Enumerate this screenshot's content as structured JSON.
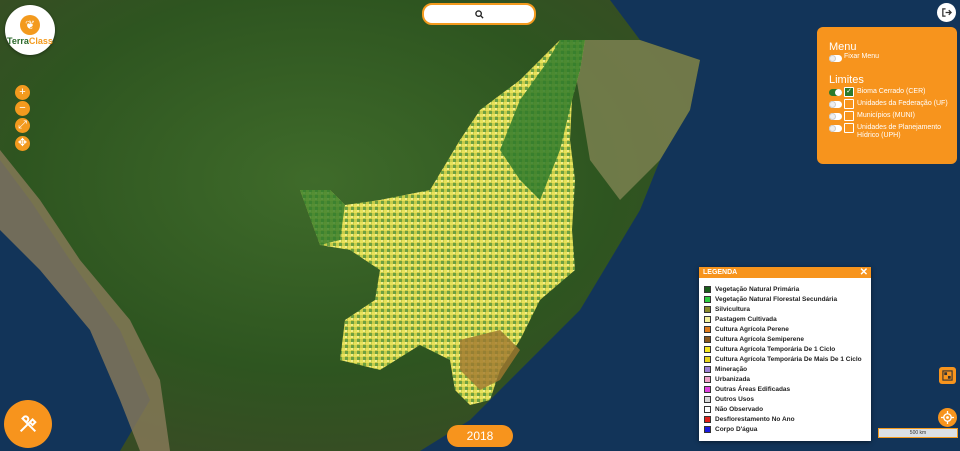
{
  "app": {
    "logo_line1": "Terra",
    "logo_line2": "Class"
  },
  "search": {
    "icon": "search-icon"
  },
  "zoom": {
    "in": "+",
    "out": "−"
  },
  "menu": {
    "title": "Menu",
    "fix_label": "Fixar Menu",
    "limits_title": "Limites",
    "limits": [
      {
        "label": "Bioma Cerrado (CER)",
        "on": true
      },
      {
        "label": "Unidades da Federação (UF)",
        "on": false
      },
      {
        "label": "Municípios (MUNI)",
        "on": false
      },
      {
        "label": "Unidades de Planejamento",
        "label2": "Hídrico (UPH)",
        "on": false
      }
    ]
  },
  "legend": {
    "title": "LEGENDA",
    "items": [
      {
        "label": "Vegetação Natural Primária",
        "color": "#1b5e1b"
      },
      {
        "label": "Vegetação Natural Florestal Secundária",
        "color": "#2ecc40"
      },
      {
        "label": "Silvicultura",
        "color": "#8a8a2a"
      },
      {
        "label": "Pastagem Cultivada",
        "color": "#f4f09a"
      },
      {
        "label": "Cultura Agrícola Perene",
        "color": "#e07b1a"
      },
      {
        "label": "Cultura Agrícola Semiperene",
        "color": "#8b5a1e"
      },
      {
        "label": "Cultura Agrícola Temporária De 1 Ciclo",
        "color": "#f5e61e"
      },
      {
        "label": "Cultura Agrícola Temporária De Mais De 1 Ciclo",
        "color": "#e6d41a"
      },
      {
        "label": "Mineração",
        "color": "#9b7fd4"
      },
      {
        "label": "Urbanizada",
        "color": "#f0a0c8"
      },
      {
        "label": "Outras Áreas Edificadas",
        "color": "#e040e0"
      },
      {
        "label": "Outros Usos",
        "color": "#d8d8d8"
      },
      {
        "label": "Não Observado",
        "color": "#ffffff"
      },
      {
        "label": "Desflorestamento No Ano",
        "color": "#e0201a"
      },
      {
        "label": "Corpo D'água",
        "color": "#1a1ae0"
      }
    ]
  },
  "year": "2018",
  "scale": "500 km"
}
